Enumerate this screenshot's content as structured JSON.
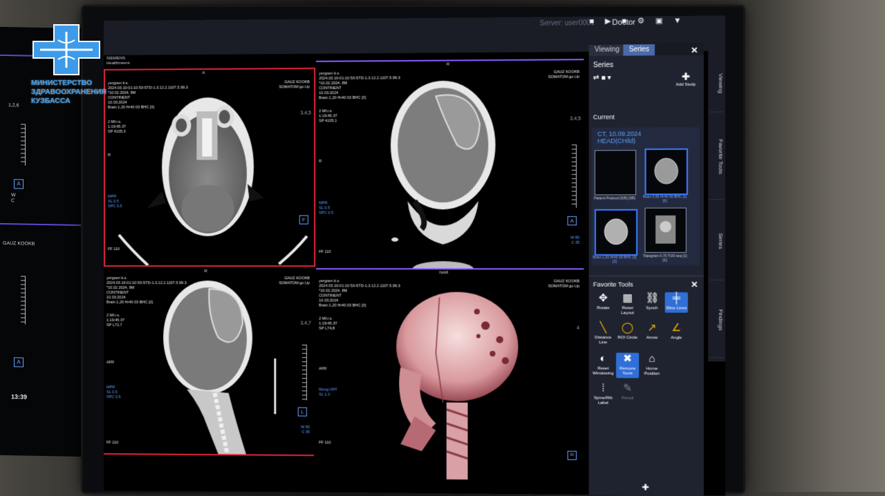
{
  "logo": {
    "org_line1": "МИНИСТЕРСТВО",
    "org_line2": "ЗДРАВООХРАНЕНИЯ",
    "org_line3": "КУЗБАССА",
    "color": "#3d9be9"
  },
  "left_monitor": {
    "tick": "1,2,6",
    "orient_top": "A",
    "orient_bottom": "A",
    "w": "W",
    "c": "C",
    "hospital": "GAUZ KOOKB",
    "time": "13:39"
  },
  "topbar": {
    "user": "Server: user0001",
    "doctor": "Doctor",
    "icons": "■ ▶ ■ ⚙ ▣ ▼"
  },
  "brand": {
    "line1": "SIEMENS",
    "line2": "Healthineers"
  },
  "viewports": [
    {
      "top_letter": "A",
      "left_text": "yergoen k.s.\n2024.03.10-01:10:53-STD-1.3.12.2.1107.5.99.3\n*10.02.2024, 8M\nCONTINENT\n10.03.2024\nBrain 1,20 Hr40 03 BHC [3]",
      "left_text2": "2 Mf.r.s.\n1:19:45.37\nSP 4105.3",
      "right_text": "GAUZ KOOKB\nSOMATOM go.Up",
      "tick": "3,4,5",
      "r_letter": "R",
      "bottom_blue": "MPR\nSL 0,5\nSPC 0,5",
      "ff": "FF 110",
      "orient": "F"
    },
    {
      "top_letter": "R",
      "left_text": "yergoen k.s.\n2024.03.10-01:10:53-STD-1.3.12.2.1107.5.99.3\n*10.02.2024, 8M\nCONTINENT\n10.03.2024\nBrain 1,20 Hr40 03 BHC [3]",
      "left_text2": "2 Mf.r.s.\n1:19:45.37\nSP 4105.1",
      "right_text": "GAUZ KOOKB\nSOMATOM go.Up",
      "tick": "3,4,5",
      "r_letter": "R",
      "bottom_blue": "MPR\nSL 0,5\nSPC 0,5",
      "w_text": "W 80\nC 35",
      "ff": "FF 110",
      "orient": "A"
    },
    {
      "top_letter": "R",
      "left_text": "yergoen k.s.\n2024.03.10-01:10:53-STD-1.3.12.2.1107.5.99.3\n*10.02.2024, 8M\nCONTINENT\n10.03.2024\nBrain 1,20 Hr40 03 BHC [3]",
      "left_text2": "2 Mf.r.s.\n1:19:45.37\nSP L72,7",
      "right_text": "GAUZ KOOKB\nSOMATOM go.Up",
      "tick": "3,4,7",
      "r_letter": "AFR",
      "bottom_blue": "MPR\nSL 0,5\nSPC 0,5",
      "w_text": "W 80\nC 35",
      "ff": "FF 110",
      "orient": "L"
    },
    {
      "top_letter": "NAR",
      "left_text": "yergoen k.s.\n2024.03.10-01:10:53-STD-1.3.12.2.1107.5.99.3\n*10.02.2024, 8M\nCONTINENT\n10.03.2024\nBrain 1,20 Hr40 03 BHC [3]",
      "left_text2": "2 Mf.r.s.\n1:19:45.37\nSP L74,8",
      "right_text": "GAUZ KOOKB\nSOMATOM go.Up",
      "tick": "4",
      "r_letter": "AFR",
      "bottom_blue": "Mong VRT\nSL 1,0",
      "ff": "FF 110",
      "orient": "3D"
    }
  ],
  "panel": {
    "tab_viewing": "Viewing",
    "tab_series": "Series",
    "series_title": "Series",
    "add_study": "Add Study",
    "current_title": "Current",
    "current_study_line1": "CT, 10.09.2024",
    "current_study_line2": "HEAD(CHild)",
    "thumbs": [
      {
        "label": "Patient Protocol\n[SR] [SR]"
      },
      {
        "label": "Brain 0,50 Hr40\n50 BHC [1] [6]"
      },
      {
        "label": "Brain 1,20 Hr40\n50 BHC [3] [3]"
      },
      {
        "label": "Topogram 0.70\nTr20 seq [1] [1]"
      }
    ],
    "favorite_title": "Favorite Tools",
    "tools": [
      {
        "label": "Rotate"
      },
      {
        "label": "Reset Layout"
      },
      {
        "label": "Synch"
      },
      {
        "label": "Slice Lines"
      },
      {
        "label": "Distance Line"
      },
      {
        "label": "ROI Circle"
      },
      {
        "label": "Arrow"
      },
      {
        "label": "Angle"
      },
      {
        "label": "Reset Windowing"
      },
      {
        "label": "Remove Tools"
      },
      {
        "label": "Home Position"
      },
      {
        "label": "Spine/Rib Label"
      },
      {
        "label": "Pencil"
      }
    ]
  },
  "side_tabs": [
    "Viewing",
    "Favorite Tools",
    "Series",
    "Findings"
  ]
}
